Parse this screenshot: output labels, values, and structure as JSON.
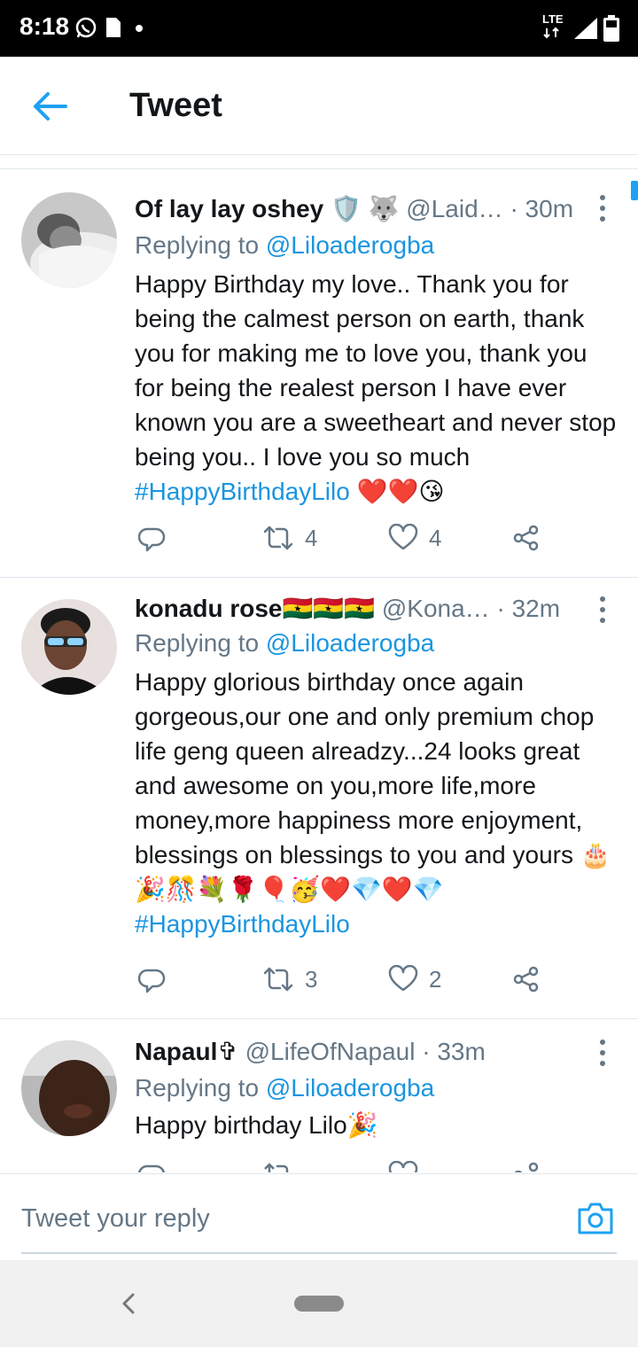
{
  "status_bar": {
    "time": "8:18",
    "network": "LTE"
  },
  "header": {
    "title": "Tweet"
  },
  "tweets": [
    {
      "name": "Of lay lay oshey",
      "name_emojis": "🛡️ 🐺",
      "handle": "@Laid…",
      "time": "· 30m",
      "reply_prefix": "Replying to",
      "reply_to": "@Liloaderogba",
      "text": "Happy Birthday my love.. Thank you for being the calmest person on earth, thank you for making me to love you, thank you for being the realest person I have ever known you are a sweetheart and never stop being you.. I love you so much",
      "hashtag": "#HappyBirthdayLilo",
      "trailing_emojis": "❤️❤️😘",
      "retweets": "4",
      "likes": "4"
    },
    {
      "name": "konadu rose",
      "name_emojis": "🇬🇭🇬🇭🇬🇭",
      "handle": "@Kona…",
      "time": "· 32m",
      "reply_prefix": "Replying to",
      "reply_to": "@Liloaderogba",
      "text": "Happy glorious birthday once again gorgeous,our one and only premium chop life geng queen alreadzy...24 looks great and awesome on you,more life,more money,more happiness more enjoyment, blessings on blessings to you and yours",
      "trailing_emojis": "🎂🎉🎊💐🌹🎈🥳❤️💎❤️💎",
      "hashtag": "#HappyBirthdayLilo",
      "retweets": "3",
      "likes": "2"
    },
    {
      "name": "Napaul",
      "name_emojis": "✞",
      "handle": "@LifeOfNapaul",
      "time": "· 33m",
      "reply_prefix": "Replying to",
      "reply_to": "@Liloaderogba",
      "text": "Happy birthday Lilo",
      "trailing_emojis": "🎉"
    }
  ],
  "composer": {
    "placeholder": "Tweet your reply"
  },
  "colors": {
    "accent": "#1da1f2",
    "link": "#1b95e0",
    "secondary_text": "#657786",
    "divider": "#e1e8ed",
    "heart": "#e0245e"
  }
}
